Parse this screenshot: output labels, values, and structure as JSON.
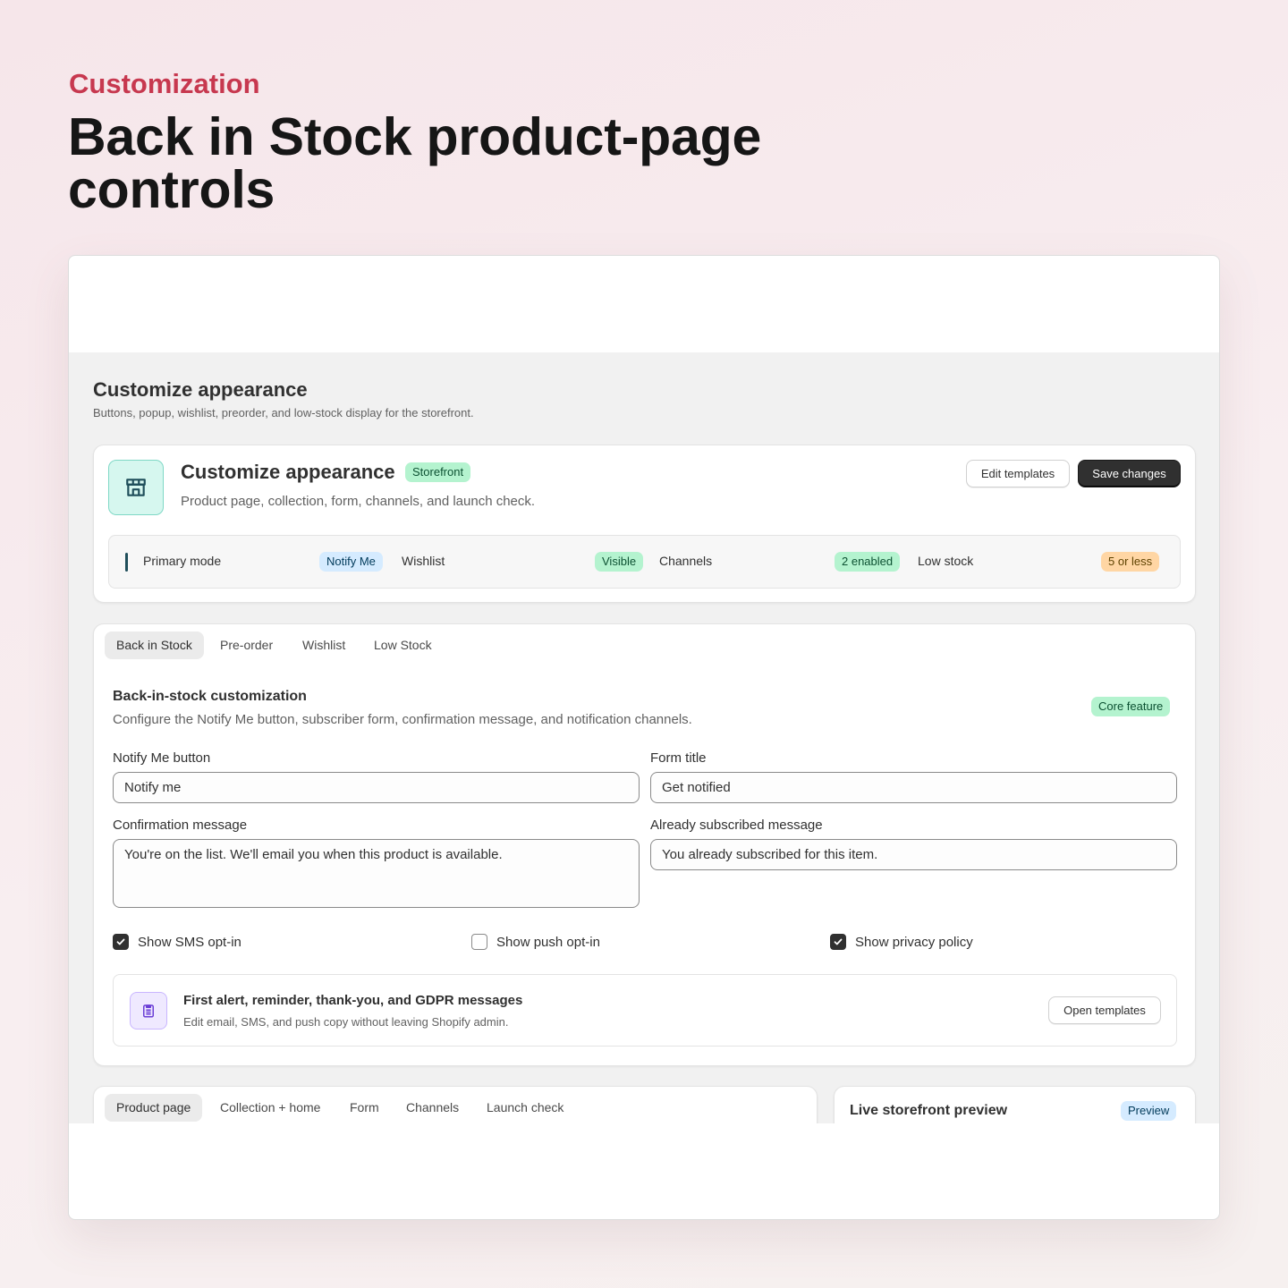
{
  "hero": {
    "eyebrow": "Customization",
    "title": "Back in Stock product-page controls"
  },
  "page": {
    "title": "Customize appearance",
    "subtitle": "Buttons, popup, wishlist, preorder, and low-stock display for the storefront."
  },
  "overview": {
    "icon": "storefront-icon",
    "title": "Customize appearance",
    "badge": "Storefront",
    "subtitle": "Product page, collection, form, channels, and launch check.",
    "edit_button": "Edit templates",
    "save_button": "Save changes",
    "summary": [
      {
        "label": "Primary mode",
        "value": "Notify Me",
        "tone": "blue"
      },
      {
        "label": "Wishlist",
        "value": "Visible",
        "tone": "green"
      },
      {
        "label": "Channels",
        "value": "2 enabled",
        "tone": "green"
      },
      {
        "label": "Low stock",
        "value": "5 or less",
        "tone": "orange"
      }
    ]
  },
  "tabs": [
    "Back in Stock",
    "Pre-order",
    "Wishlist",
    "Low Stock"
  ],
  "active_tab": "Back in Stock",
  "section": {
    "title": "Back-in-stock customization",
    "subtitle": "Configure the Notify Me button, subscriber form, confirmation message, and notification channels.",
    "badge": "Core feature",
    "fields": {
      "notify_label": "Notify Me button",
      "notify_value": "Notify me",
      "form_title_label": "Form title",
      "form_title_value": "Get notified",
      "confirmation_label": "Confirmation message",
      "confirmation_value": "You're on the list. We'll email you when this product is available.",
      "subscribed_label": "Already subscribed message",
      "subscribed_value": "You already subscribed for this item."
    },
    "checkboxes": [
      {
        "label": "Show SMS opt-in",
        "checked": true
      },
      {
        "label": "Show push opt-in",
        "checked": false
      },
      {
        "label": "Show privacy policy",
        "checked": true
      }
    ],
    "templates": {
      "icon": "clipboard-icon",
      "title": "First alert, reminder, thank-you, and GDPR messages",
      "subtitle": "Edit email, SMS, and push copy without leaving Shopify admin.",
      "button": "Open templates"
    }
  },
  "lower_tabs": [
    "Product page",
    "Collection + home",
    "Form",
    "Channels",
    "Launch check"
  ],
  "preview": {
    "title": "Live storefront preview",
    "badge": "Preview"
  },
  "colors": {
    "accent": "#c7384f",
    "primary_button": "#303030",
    "success_badge": "#b4f3cf",
    "info_badge": "#d5ebff",
    "warning_badge": "#ffd6a4",
    "store_icon_bg": "#d6f7ef",
    "template_icon_bg": "#efe9ff"
  }
}
